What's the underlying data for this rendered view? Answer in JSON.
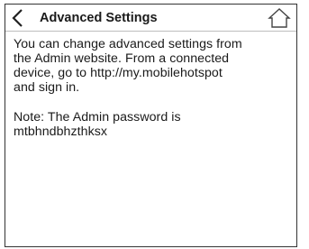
{
  "header": {
    "back_icon": "chevron-left-icon",
    "title": "Advanced Settings",
    "home_icon": "home-icon"
  },
  "content": {
    "intro_lines": [
      "You can change advanced settings from",
      "the Admin website. From a connected",
      "device, go to http://my.mobilehotspot",
      "and sign in."
    ],
    "note_lines": [
      "Note: The Admin password is",
      "mtbhndbhzthksx"
    ]
  }
}
